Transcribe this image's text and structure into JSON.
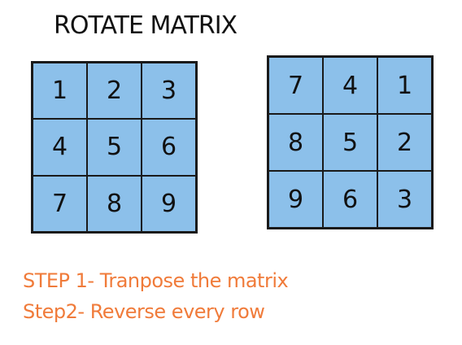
{
  "title": "ROTATE MATRIX",
  "original_matrix": [
    [
      "1",
      "2",
      "3"
    ],
    [
      "4",
      "5",
      "6"
    ],
    [
      "7",
      "8",
      "9"
    ]
  ],
  "rotated_matrix": [
    [
      "7",
      "4",
      "1"
    ],
    [
      "8",
      "5",
      "2"
    ],
    [
      "9",
      "6",
      "3"
    ]
  ],
  "steps": [
    "STEP 1- Tranpose the matrix",
    "Step2- Reverse every row"
  ],
  "colors": {
    "cell_fill": "#8cc0ea",
    "step_text": "#f07b3a",
    "grid_line": "#1a1a1a"
  }
}
